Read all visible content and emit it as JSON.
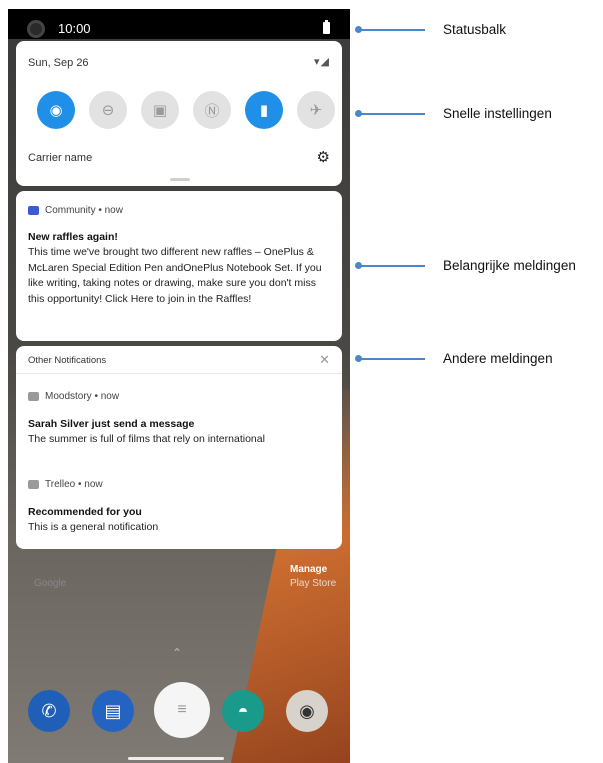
{
  "status_bar": {
    "time": "10:00"
  },
  "quick_settings": {
    "date": "Sun, Sep 26",
    "carrier": "Carrier name",
    "tiles": [
      {
        "icon": "wifi-icon",
        "glyph": "◉",
        "on": true
      },
      {
        "icon": "do-not-disturb-icon",
        "glyph": "⊖",
        "on": false
      },
      {
        "icon": "sim-icon",
        "glyph": "▣",
        "on": false
      },
      {
        "icon": "nfc-icon",
        "glyph": "Ⓝ",
        "on": false
      },
      {
        "icon": "battery-saver-icon",
        "glyph": "▮",
        "on": true
      },
      {
        "icon": "airplane-icon",
        "glyph": "✈",
        "on": false
      }
    ]
  },
  "important": {
    "app": "Community • now",
    "title": "New raffles again!",
    "body": "This time we've brought two different new raffles – OnePlus & McLaren Special Edition Pen andOnePlus Notebook Set. If you like writing, taking notes or drawing, make sure you don't miss this opportunity! Click Here to join in the Raffles!"
  },
  "other": {
    "header": "Other Notifications",
    "items": [
      {
        "app": "Moodstory • now",
        "title": "Sarah Silver just send a message",
        "body": "The summer is full of films that rely on international"
      },
      {
        "app": "Trelleo • now",
        "title": "Recommended for you",
        "body": "This is a general notification"
      }
    ]
  },
  "home": {
    "google_label": "Google",
    "manage_label": "Manage",
    "playstore_label": "Play Store"
  },
  "callouts": {
    "statusbar": "Statusbalk",
    "quick_settings": "Snelle instellingen",
    "important": "Belangrijke meldingen",
    "other": "Andere meldingen"
  },
  "colors": {
    "accent": "#1f8fe8",
    "callout": "#4a86c8",
    "community_icon": "#3b5bd6"
  }
}
